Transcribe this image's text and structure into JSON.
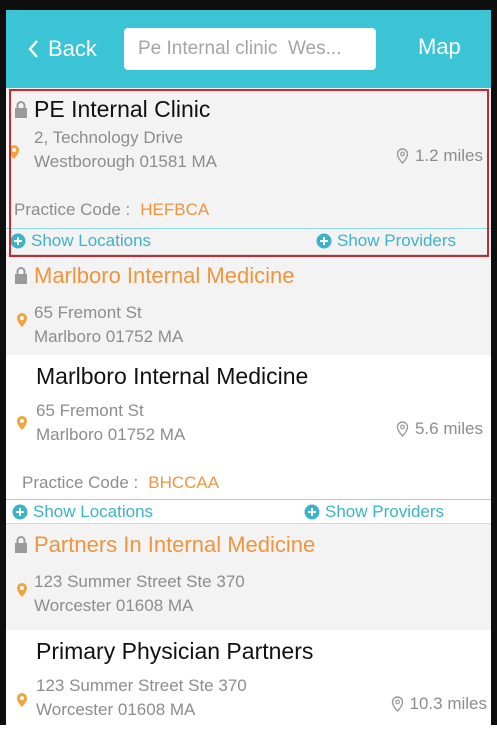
{
  "nav": {
    "back_label": "Back",
    "search_value": "Pe Internal clinic  Wes...",
    "map_label": "Map"
  },
  "practices": [
    {
      "name": "PE Internal Clinic",
      "address1": "2, Technology Drive",
      "address2": "Westborough 01581 MA",
      "distance": "1.2 miles",
      "code_label": "Practice Code :",
      "code": "HEFBCA",
      "show_locations": "Show Locations",
      "show_providers": "Show Providers"
    },
    {
      "group_name": "Marlboro Internal Medicine",
      "group_address1": "65 Fremont St",
      "group_address2": "Marlboro 01752 MA",
      "name": "Marlboro Internal Medicine",
      "address1": "65 Fremont St",
      "address2": "Marlboro 01752 MA",
      "distance": "5.6 miles",
      "code_label": "Practice Code :",
      "code": "BHCCAA",
      "show_locations": "Show Locations",
      "show_providers": "Show Providers"
    },
    {
      "group_name": "Partners In Internal Medicine",
      "group_address1": "123 Summer Street Ste 370",
      "group_address2": "Worcester 01608 MA",
      "name": "Primary Physician Partners",
      "address1": "123 Summer Street Ste 370",
      "address2": "Worcester 01608 MA",
      "distance": "10.3 miles"
    }
  ],
  "colors": {
    "nav_bg": "#3bc3d6",
    "accent_orange": "#f0953d",
    "link_blue": "#3bb3c9",
    "selection_border": "#c8282e"
  }
}
